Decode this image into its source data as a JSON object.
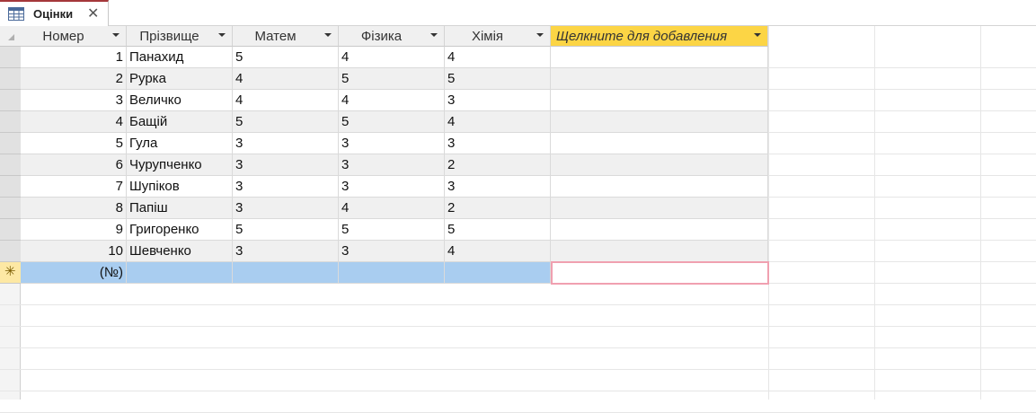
{
  "tab": {
    "label": "Оцінки",
    "icon": "table-icon"
  },
  "columns": [
    {
      "label": "Номер"
    },
    {
      "label": "Прізвище"
    },
    {
      "label": "Матем"
    },
    {
      "label": "Фізика"
    },
    {
      "label": "Хімія"
    },
    {
      "label": "Щелкните для добавления"
    }
  ],
  "rows": [
    {
      "num": "1",
      "name": "Панахид",
      "math": "5",
      "phys": "4",
      "chem": "4"
    },
    {
      "num": "2",
      "name": "Рурка",
      "math": "4",
      "phys": "5",
      "chem": "5"
    },
    {
      "num": "3",
      "name": "Величко",
      "math": "4",
      "phys": "4",
      "chem": "3"
    },
    {
      "num": "4",
      "name": "Бащій",
      "math": "5",
      "phys": "5",
      "chem": "4"
    },
    {
      "num": "5",
      "name": "Гула",
      "math": "3",
      "phys": "3",
      "chem": "3"
    },
    {
      "num": "6",
      "name": "Чурупченко",
      "math": "3",
      "phys": "3",
      "chem": "2"
    },
    {
      "num": "7",
      "name": "Шупіков",
      "math": "3",
      "phys": "3",
      "chem": "3"
    },
    {
      "num": "8",
      "name": "Папіш",
      "math": "3",
      "phys": "4",
      "chem": "2"
    },
    {
      "num": "9",
      "name": "Григоренко",
      "math": "5",
      "phys": "5",
      "chem": "5"
    },
    {
      "num": "10",
      "name": "Шевченко",
      "math": "3",
      "phys": "3",
      "chem": "4"
    }
  ],
  "new_row": {
    "placeholder": "(№)",
    "marker": "✳"
  },
  "colors": {
    "accent": "#a4373a",
    "add_column": "#fcd545",
    "new_row": "#a9cdf0",
    "alt_row": "#f0f0f0"
  }
}
